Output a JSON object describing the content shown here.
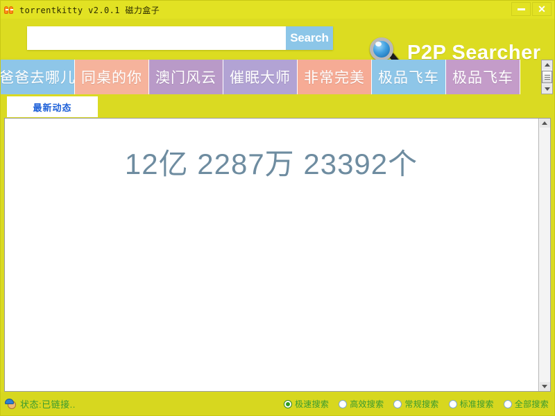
{
  "window": {
    "title": "torrentkitty v2.0.1 磁力盒子",
    "app_icon": "kitty-icon",
    "minimize_label": "—",
    "close_label": "✕",
    "bg_color": "#dada22"
  },
  "header": {
    "search": {
      "value": "",
      "placeholder": "",
      "button_label": "Search",
      "button_color": "#8cc6e8"
    },
    "brand": {
      "title": "P2P Searcher",
      "icon": "magnifier-icon"
    }
  },
  "movie_tabs": {
    "items": [
      {
        "label": "爸爸去哪儿",
        "color": "#8ec6e8"
      },
      {
        "label": "同桌的你",
        "color": "#f6b39c"
      },
      {
        "label": "澳门风云",
        "color": "#b99ac8"
      },
      {
        "label": "催眠大师",
        "color": "#b2a3d4"
      },
      {
        "label": "非常完美",
        "color": "#f6ab95"
      },
      {
        "label": "极品飞车",
        "color": "#8ec6e8"
      },
      {
        "label": "极品飞车",
        "color": "#c49cc9"
      }
    ],
    "scrollbar": {
      "up_icon": "triangle-up-icon",
      "down_icon": "triangle-down-icon",
      "thumb": "scroll-thumb"
    }
  },
  "sub_tabs": {
    "items": [
      {
        "label": "最新动态",
        "active": true,
        "color": "#1c5fd8"
      }
    ]
  },
  "content": {
    "result_count": "12亿 2287万 23392个",
    "text_color": "#6e8ca0",
    "scrollbar": {
      "up_icon": "triangle-up-icon",
      "down_icon": "triangle-down-icon"
    }
  },
  "status_bar": {
    "icon": "connection-kitty-icon",
    "text": "状态:已链接..",
    "text_color": "#3a9b2f",
    "search_modes": [
      {
        "label": "极速搜索",
        "checked": true
      },
      {
        "label": "高效搜索",
        "checked": false
      },
      {
        "label": "常规搜索",
        "checked": false
      },
      {
        "label": "标准搜索",
        "checked": false
      },
      {
        "label": "全部搜索",
        "checked": false
      }
    ]
  }
}
